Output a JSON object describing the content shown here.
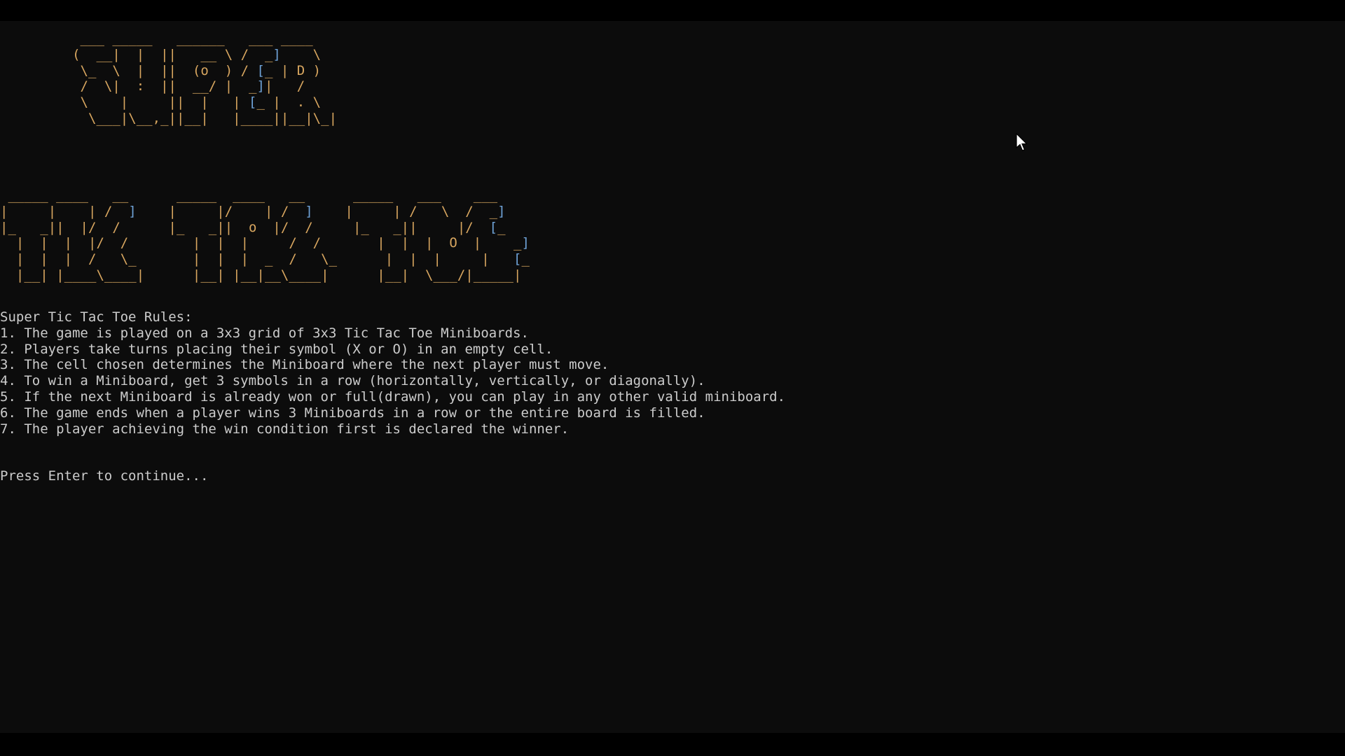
{
  "window": {
    "type": "terminal",
    "background": "#0c0c0c",
    "text_color": "#cccccc",
    "ascii_color": "#d9a760",
    "accent_color": "#6fa3d8"
  },
  "banner": {
    "super_art": [
      "          ___ _____   ______   ___ ____",
      "         (  __|  |  ||   __ \\ /  _]    \\",
      "          \\_  \\  |  ||  (o  ) / [_ | D )",
      "          /  \\|  :  ||  __/ |  _]|   /",
      "          \\    |     ||  |   | [_ |  . \\",
      "           \\___|\\__,_||__|   |____||__|\\_|"
    ],
    "tictactoe_art": [
      " _____ ____   __      _____  ____   __      _____   ___    ___",
      "|     |    | /  ]    |     |/    | /  ]    |     | /   \\  /  _]",
      "|_   _||  |/  /      |_   _||  o  |/  /     |_   _||     |/  [_",
      "  |  |  |  |/  /        |  |  |     /  /       |  |  |  O  |    _]",
      "  |  |  |  /   \\_       |  |  |  _  /   \\_      |  |  |     |   [_",
      "  |__| |____\\____|      |__| |__|__\\____|      |__|  \\___/|_____|"
    ]
  },
  "rules": {
    "title": "Super Tic Tac Toe Rules:",
    "items": [
      "1. The game is played on a 3x3 grid of 3x3 Tic Tac Toe Miniboards.",
      "2. Players take turns placing their symbol (X or O) in an empty cell.",
      "3. The cell chosen determines the Miniboard where the next player must move.",
      "4. To win a Miniboard, get 3 symbols in a row (horizontally, vertically, or diagonally).",
      "5. If the next Miniboard is already won or full(drawn), you can play in any other valid miniboard.",
      "6. The game ends when a player wins 3 Miniboards in a row or the entire board is filled.",
      "7. The player achieving the win condition first is declared the winner."
    ]
  },
  "prompt": {
    "text": "Press Enter to continue..."
  },
  "cursor": {
    "icon": "mouse-pointer-icon"
  }
}
